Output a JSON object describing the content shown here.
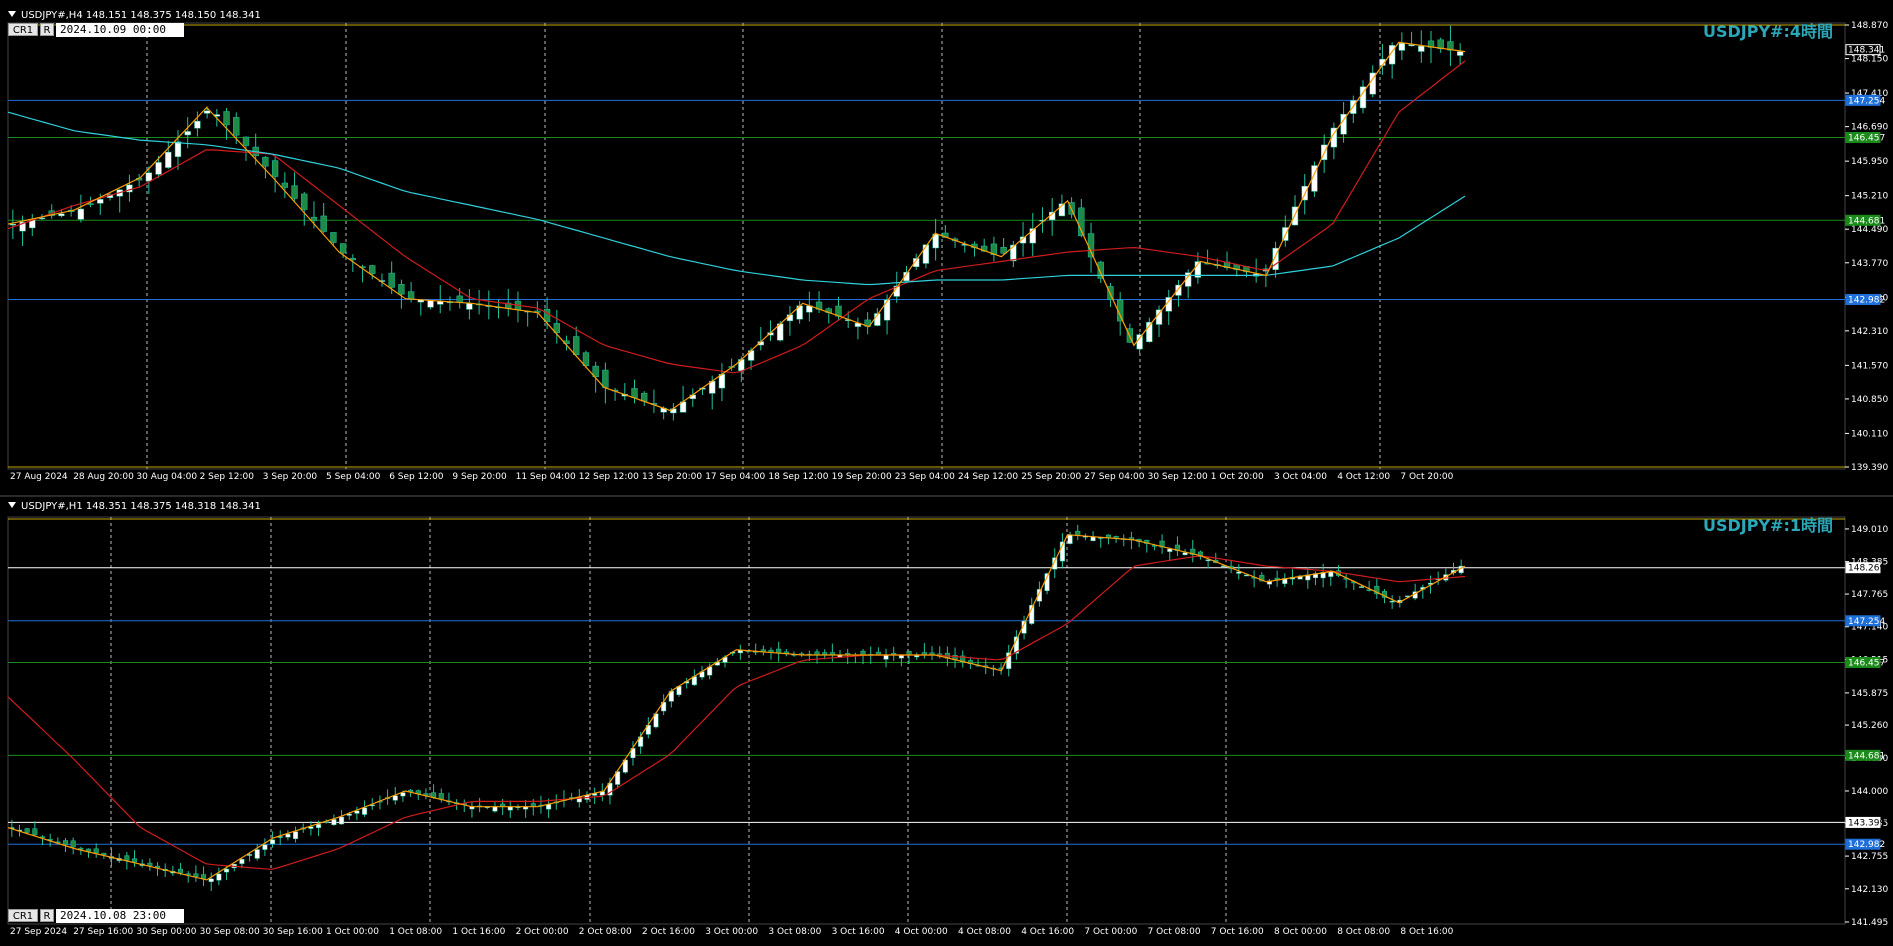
{
  "top": {
    "header": "USDJPY#,H4  148.151 148.375 148.150 148.341",
    "cr_label": "CR1",
    "r_label": "R",
    "datetime": "2024.10.09 00:00",
    "watermark": "USDJPY#:4時間",
    "price_ticks": [
      "148.870",
      "148.150",
      "147.410",
      "146.690",
      "145.950",
      "145.210",
      "144.490",
      "143.770",
      "143.030",
      "142.310",
      "141.570",
      "140.850",
      "140.110",
      "139.390"
    ],
    "price_labels": [
      {
        "text": "148.341",
        "color": "#ffffff",
        "bg": "#000000"
      },
      {
        "text": "147.254",
        "color": "#ffffff",
        "bg": "#1e6fd9"
      },
      {
        "text": "146.457",
        "color": "#ffffff",
        "bg": "#1a8a1a"
      },
      {
        "text": "144.681",
        "color": "#ffffff",
        "bg": "#1a8a1a"
      },
      {
        "text": "142.982",
        "color": "#ffffff",
        "bg": "#1e6fd9"
      }
    ],
    "time_ticks": [
      "27 Aug 2024",
      "28 Aug 20:00",
      "30 Aug 04:00",
      "2 Sep 12:00",
      "3 Sep 20:00",
      "5 Sep 04:00",
      "6 Sep 12:00",
      "9 Sep 20:00",
      "11 Sep 04:00",
      "12 Sep 12:00",
      "13 Sep 20:00",
      "17 Sep 04:00",
      "18 Sep 12:00",
      "19 Sep 20:00",
      "23 Sep 04:00",
      "24 Sep 12:00",
      "25 Sep 20:00",
      "27 Sep 04:00",
      "30 Sep 12:00",
      "1 Oct 20:00",
      "3 Oct 04:00",
      "4 Oct 12:00",
      "7 Oct 20:00"
    ]
  },
  "bottom": {
    "header": "USDJPY#,H1  148.351 148.375 148.318 148.341",
    "cr_label": "CR1",
    "r_label": "R",
    "datetime": "2024.10.08 23:00",
    "watermark": "USDJPY#:1時間",
    "price_ticks": [
      "149.010",
      "148.385",
      "147.765",
      "147.140",
      "146.515",
      "145.875",
      "145.260",
      "144.630",
      "144.000",
      "143.385",
      "142.755",
      "142.130",
      "141.495"
    ],
    "price_labels": [
      {
        "text": "148.269",
        "color": "#000000",
        "bg": "#ffffff"
      },
      {
        "text": "147.254",
        "color": "#ffffff",
        "bg": "#1e6fd9"
      },
      {
        "text": "146.457",
        "color": "#ffffff",
        "bg": "#1a8a1a"
      },
      {
        "text": "144.681",
        "color": "#ffffff",
        "bg": "#1a8a1a"
      },
      {
        "text": "143.399",
        "color": "#000000",
        "bg": "#ffffff"
      },
      {
        "text": "142.982",
        "color": "#ffffff",
        "bg": "#1e6fd9"
      }
    ],
    "time_ticks": [
      "27 Sep 2024",
      "27 Sep 16:00",
      "30 Sep 00:00",
      "30 Sep 08:00",
      "30 Sep 16:00",
      "1 Oct 00:00",
      "1 Oct 08:00",
      "1 Oct 16:00",
      "2 Oct 00:00",
      "2 Oct 08:00",
      "2 Oct 16:00",
      "3 Oct 00:00",
      "3 Oct 08:00",
      "3 Oct 16:00",
      "4 Oct 00:00",
      "4 Oct 08:00",
      "4 Oct 16:00",
      "7 Oct 00:00",
      "7 Oct 08:00",
      "7 Oct 16:00",
      "8 Oct 00:00",
      "8 Oct 08:00",
      "8 Oct 16:00"
    ]
  },
  "colors": {
    "candle": "#22c3a1",
    "up": "#ffffff",
    "down": "#1d8a46",
    "ma_fast": "#d01c1c",
    "ma_slow": "#2fd0dc",
    "zigzag": "#ff9d00",
    "grid": "#bbbbbb",
    "hline_blue": "#1e6fd9",
    "hline_green": "#1a8a1a",
    "hline_white": "#ffffff",
    "hline_gold": "#c8a800",
    "tick_icon": "#ff9d00"
  },
  "chart_data": [
    {
      "type": "line",
      "title": "USDJPY#,H4",
      "x": [
        "27 Aug 2024",
        "28 Aug 20:00",
        "30 Aug 04:00",
        "2 Sep 12:00",
        "3 Sep 20:00",
        "5 Sep 04:00",
        "6 Sep 12:00",
        "9 Sep 20:00",
        "11 Sep 04:00",
        "12 Sep 12:00",
        "13 Sep 20:00",
        "17 Sep 04:00",
        "18 Sep 12:00",
        "19 Sep 20:00",
        "23 Sep 04:00",
        "24 Sep 12:00",
        "25 Sep 20:00",
        "27 Sep 04:00",
        "30 Sep 12:00",
        "1 Oct 20:00",
        "3 Oct 04:00",
        "4 Oct 12:00",
        "7 Oct 20:00"
      ],
      "series": [
        {
          "values": [
            144.6,
            144.9,
            145.6,
            147.1,
            145.6,
            144.0,
            143.0,
            142.9,
            142.7,
            141.1,
            140.6,
            141.6,
            142.9,
            142.4,
            144.4,
            143.9,
            145.1,
            142.0,
            143.8,
            143.5,
            146.5,
            148.5,
            148.3
          ]
        },
        {
          "values": [
            144.5,
            145.0,
            145.4,
            146.2,
            146.1,
            145.0,
            143.9,
            143.0,
            142.8,
            142.0,
            141.6,
            141.4,
            142.0,
            143.0,
            143.6,
            143.8,
            144.0,
            144.1,
            143.9,
            143.6,
            144.6,
            147.0,
            148.1
          ]
        },
        {
          "values": [
            147.0,
            146.6,
            146.4,
            146.3,
            146.1,
            145.8,
            145.3,
            145.0,
            144.7,
            144.3,
            143.9,
            143.6,
            143.4,
            143.3,
            143.4,
            143.4,
            143.5,
            143.5,
            143.5,
            143.5,
            143.7,
            144.3,
            145.2
          ]
        }
      ],
      "ylim": [
        139.39,
        148.87
      ]
    },
    {
      "type": "line",
      "title": "USDJPY#,H1",
      "x": [
        "27 Sep 2024",
        "27 Sep 16:00",
        "30 Sep 00:00",
        "30 Sep 08:00",
        "30 Sep 16:00",
        "1 Oct 00:00",
        "1 Oct 08:00",
        "1 Oct 16:00",
        "2 Oct 00:00",
        "2 Oct 08:00",
        "2 Oct 16:00",
        "3 Oct 00:00",
        "3 Oct 08:00",
        "3 Oct 16:00",
        "4 Oct 00:00",
        "4 Oct 08:00",
        "4 Oct 16:00",
        "7 Oct 00:00",
        "7 Oct 08:00",
        "7 Oct 16:00",
        "8 Oct 00:00",
        "8 Oct 08:00",
        "8 Oct 16:00"
      ],
      "series": [
        {
          "values": [
            143.3,
            142.9,
            142.6,
            142.3,
            143.1,
            143.5,
            144.0,
            143.7,
            143.7,
            144.0,
            145.9,
            146.7,
            146.6,
            146.6,
            146.6,
            146.3,
            148.9,
            148.8,
            148.5,
            148.0,
            148.2,
            147.6,
            148.3
          ]
        },
        {
          "values": [
            145.8,
            144.6,
            143.3,
            142.6,
            142.5,
            142.9,
            143.5,
            143.8,
            143.8,
            143.9,
            144.7,
            146.0,
            146.5,
            146.6,
            146.6,
            146.5,
            147.2,
            148.3,
            148.5,
            148.3,
            148.2,
            148.0,
            148.1
          ]
        }
      ],
      "ylim": [
        141.495,
        149.2
      ]
    }
  ]
}
